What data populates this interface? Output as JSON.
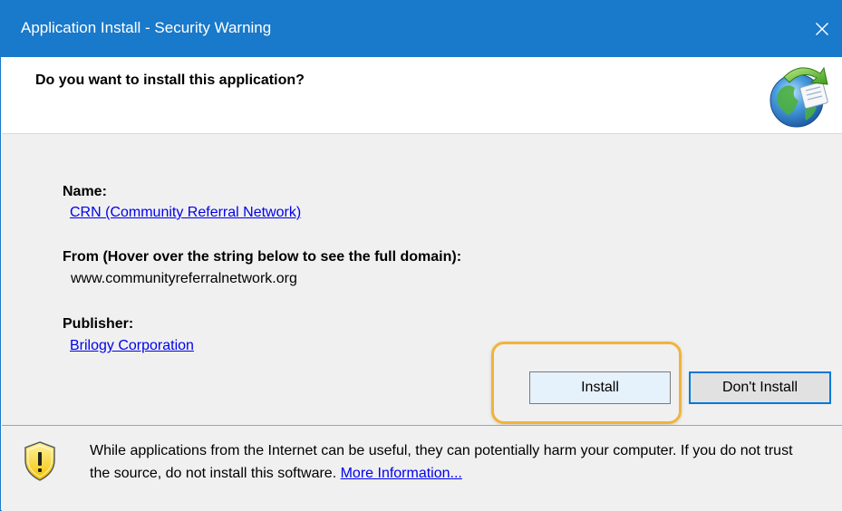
{
  "window": {
    "title": "Application Install - Security Warning"
  },
  "header": {
    "question": "Do you want to install this application?"
  },
  "details": {
    "name_label": "Name:",
    "name_value": "CRN (Community Referral Network)",
    "from_label": "From (Hover over the string below to see the full domain):",
    "from_value": "www.communityreferralnetwork.org",
    "publisher_label": "Publisher:",
    "publisher_value": "Brilogy Corporation"
  },
  "buttons": {
    "install": "Install",
    "dont_install": "Don't Install"
  },
  "footer": {
    "warning_text": "While applications from the Internet can be useful, they can potentially harm your computer. If you do not trust the source, do not install this software.",
    "more_info_link": "More Information..."
  },
  "colors": {
    "titlebar": "#1979ca",
    "link": "#0000ee",
    "highlight": "#f0b43c",
    "panel": "#f0f0f0"
  },
  "icons": {
    "close": "close-icon",
    "app": "globe-app-icon",
    "warning": "warning-shield-icon"
  }
}
